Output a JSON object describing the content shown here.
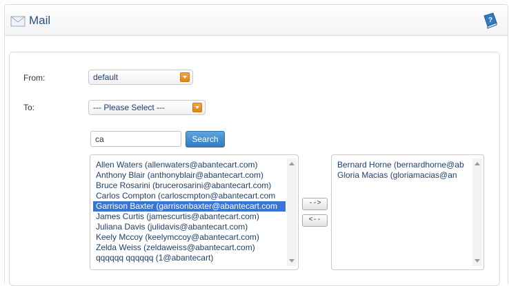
{
  "header": {
    "title": "Mail",
    "icons": {
      "left": "envelope-icon",
      "right": "help-book-icon"
    }
  },
  "form": {
    "from_label": "From:",
    "from_value": "default",
    "to_label": "To:",
    "to_value": "--- Please Select ---"
  },
  "search": {
    "value": "ca",
    "button_label": "Search"
  },
  "available_list": [
    "Allen Waters (allenwaters@abantecart.com)",
    "Anthony Blair (anthonyblair@abantecart.com)",
    "Bruce Rosarini (brucerosarini@abantecart.com)",
    "Carlos Compton (carloscmpton@abantecart.com",
    "Garrison Baxter (garrisonbaxter@abantecart.com",
    "James Curtis (jamescurtis@abantecart.com)",
    "Juliana Davis (julidavis@abantecart.com)",
    "Keely Mccoy (keelymccoy@abantecart.com)",
    "Zelda Weiss (zeldaweiss@abantecart.com)",
    "qqqqqq qqqqqq (1@abantecart)"
  ],
  "selected_index": 4,
  "move_buttons": {
    "add": "-->",
    "remove": "<--"
  },
  "selected_list": [
    "Bernard Horne (bernardhorne@ab",
    "Gloria Macias (gloriamacias@an"
  ],
  "colors": {
    "accent": "#3875d7",
    "title": "#27517a",
    "button": "#2f7cc0"
  }
}
